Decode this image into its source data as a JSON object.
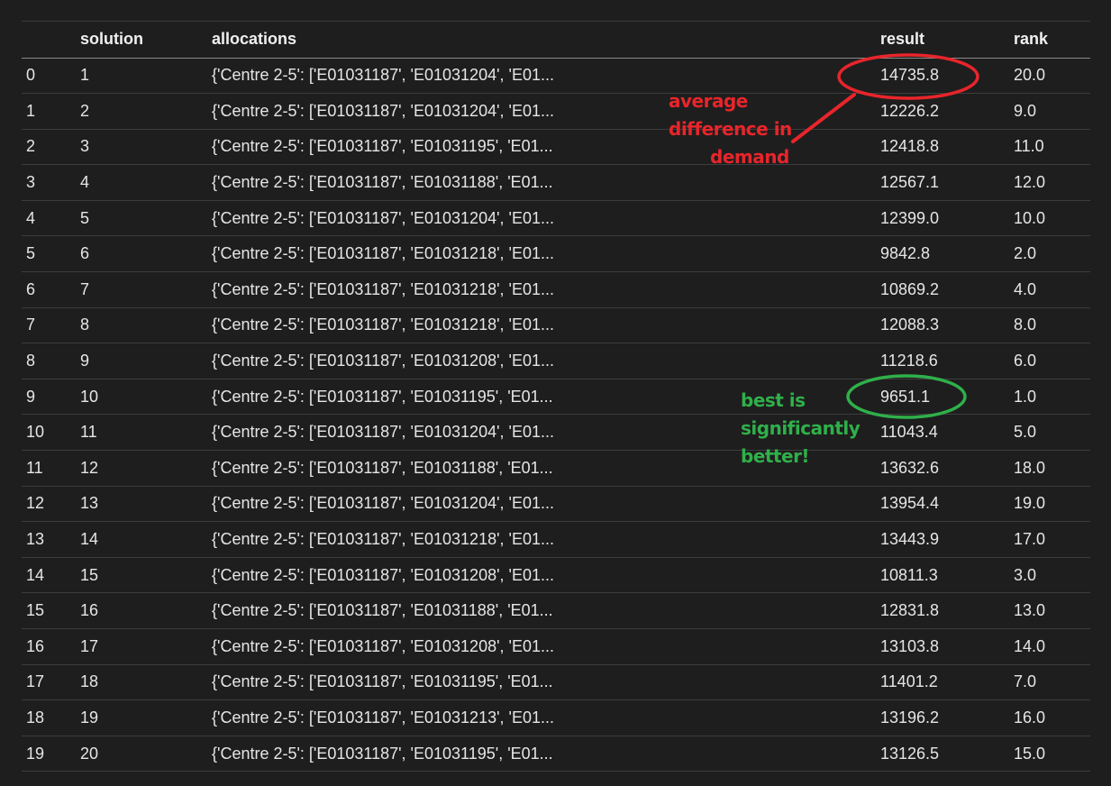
{
  "table": {
    "columns": [
      "",
      "solution",
      "allocations",
      "result",
      "rank"
    ],
    "rows": [
      {
        "index": "0",
        "solution": "1",
        "allocations": "{'Centre 2-5': ['E01031187', 'E01031204', 'E01...",
        "result": "14735.8",
        "rank": "20.0"
      },
      {
        "index": "1",
        "solution": "2",
        "allocations": "{'Centre 2-5': ['E01031187', 'E01031204', 'E01...",
        "result": "12226.2",
        "rank": "9.0"
      },
      {
        "index": "2",
        "solution": "3",
        "allocations": "{'Centre 2-5': ['E01031187', 'E01031195', 'E01...",
        "result": "12418.8",
        "rank": "11.0"
      },
      {
        "index": "3",
        "solution": "4",
        "allocations": "{'Centre 2-5': ['E01031187', 'E01031188', 'E01...",
        "result": "12567.1",
        "rank": "12.0"
      },
      {
        "index": "4",
        "solution": "5",
        "allocations": "{'Centre 2-5': ['E01031187', 'E01031204', 'E01...",
        "result": "12399.0",
        "rank": "10.0"
      },
      {
        "index": "5",
        "solution": "6",
        "allocations": "{'Centre 2-5': ['E01031187', 'E01031218', 'E01...",
        "result": "9842.8",
        "rank": "2.0"
      },
      {
        "index": "6",
        "solution": "7",
        "allocations": "{'Centre 2-5': ['E01031187', 'E01031218', 'E01...",
        "result": "10869.2",
        "rank": "4.0"
      },
      {
        "index": "7",
        "solution": "8",
        "allocations": "{'Centre 2-5': ['E01031187', 'E01031218', 'E01...",
        "result": "12088.3",
        "rank": "8.0"
      },
      {
        "index": "8",
        "solution": "9",
        "allocations": "{'Centre 2-5': ['E01031187', 'E01031208', 'E01...",
        "result": "11218.6",
        "rank": "6.0"
      },
      {
        "index": "9",
        "solution": "10",
        "allocations": "{'Centre 2-5': ['E01031187', 'E01031195', 'E01...",
        "result": "9651.1",
        "rank": "1.0"
      },
      {
        "index": "10",
        "solution": "11",
        "allocations": "{'Centre 2-5': ['E01031187', 'E01031204', 'E01...",
        "result": "11043.4",
        "rank": "5.0"
      },
      {
        "index": "11",
        "solution": "12",
        "allocations": "{'Centre 2-5': ['E01031187', 'E01031188', 'E01...",
        "result": "13632.6",
        "rank": "18.0"
      },
      {
        "index": "12",
        "solution": "13",
        "allocations": "{'Centre 2-5': ['E01031187', 'E01031204', 'E01...",
        "result": "13954.4",
        "rank": "19.0"
      },
      {
        "index": "13",
        "solution": "14",
        "allocations": "{'Centre 2-5': ['E01031187', 'E01031218', 'E01...",
        "result": "13443.9",
        "rank": "17.0"
      },
      {
        "index": "14",
        "solution": "15",
        "allocations": "{'Centre 2-5': ['E01031187', 'E01031208', 'E01...",
        "result": "10811.3",
        "rank": "3.0"
      },
      {
        "index": "15",
        "solution": "16",
        "allocations": "{'Centre 2-5': ['E01031187', 'E01031188', 'E01...",
        "result": "12831.8",
        "rank": "13.0"
      },
      {
        "index": "16",
        "solution": "17",
        "allocations": "{'Centre 2-5': ['E01031187', 'E01031208', 'E01...",
        "result": "13103.8",
        "rank": "14.0"
      },
      {
        "index": "17",
        "solution": "18",
        "allocations": "{'Centre 2-5': ['E01031187', 'E01031195', 'E01...",
        "result": "11401.2",
        "rank": "7.0"
      },
      {
        "index": "18",
        "solution": "19",
        "allocations": "{'Centre 2-5': ['E01031187', 'E01031213', 'E01...",
        "result": "13196.2",
        "rank": "16.0"
      },
      {
        "index": "19",
        "solution": "20",
        "allocations": "{'Centre 2-5': ['E01031187', 'E01031195', 'E01...",
        "result": "13126.5",
        "rank": "15.0"
      }
    ]
  },
  "annotations": {
    "red_note": [
      "average",
      "difference in",
      "demand"
    ],
    "green_note": [
      "best is",
      "significantly",
      "better!"
    ],
    "red_color": "#e8252b",
    "green_color": "#2fb04a"
  },
  "colors": {
    "background": "#1e1e1e",
    "text": "#e6e6e6"
  }
}
